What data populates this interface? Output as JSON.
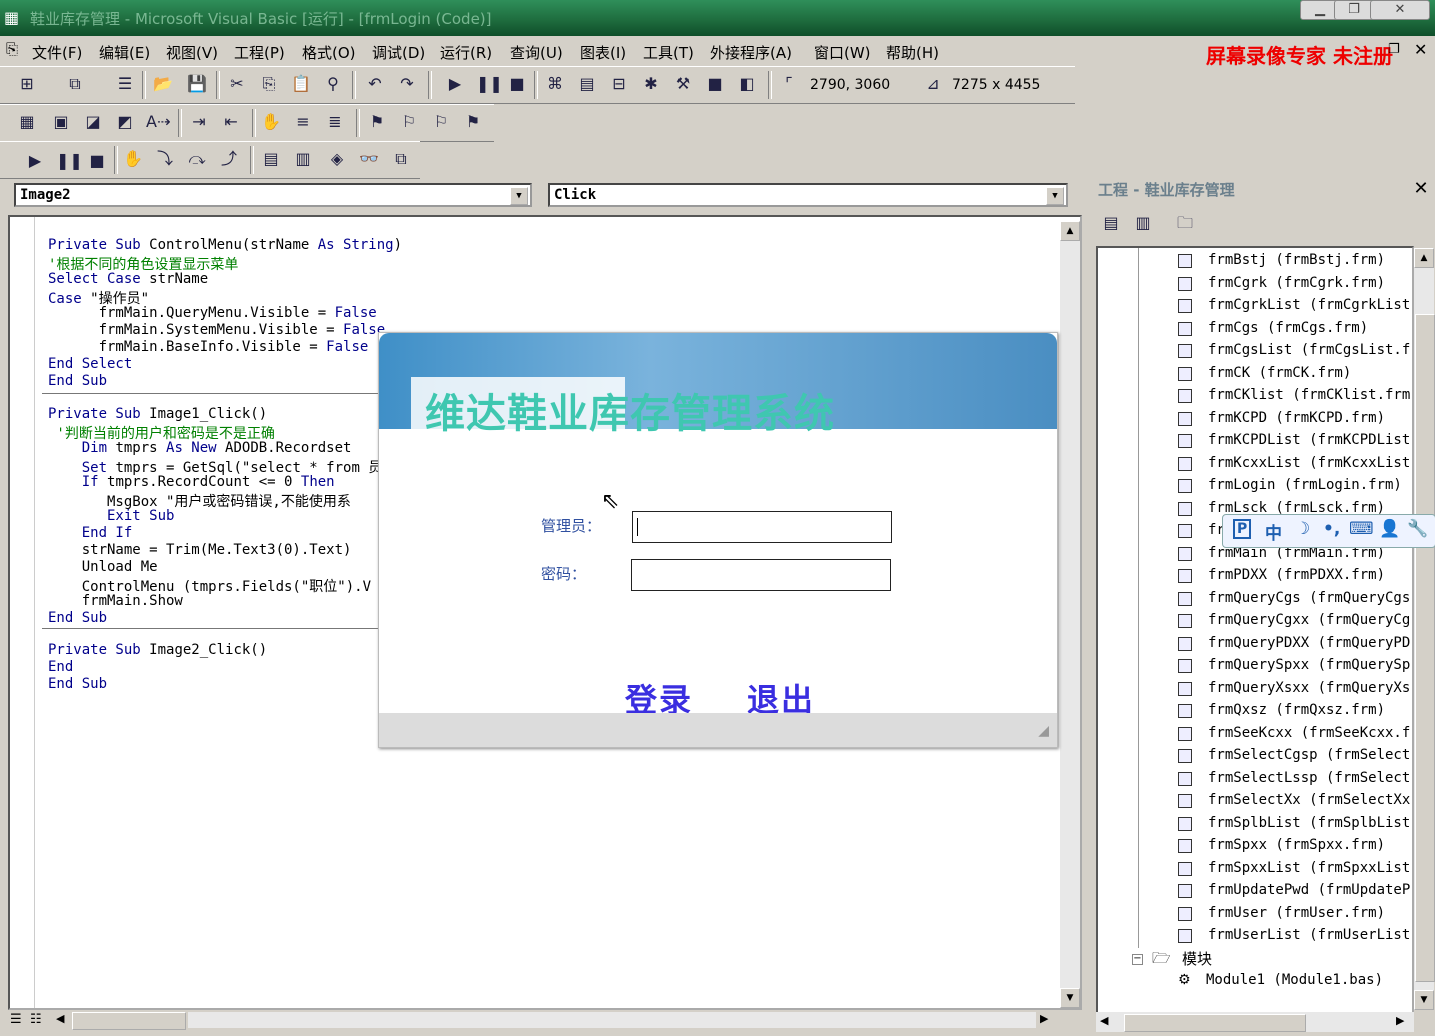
{
  "window": {
    "title": "鞋业库存管理 - Microsoft Visual Basic [运行] - [frmLogin (Code)]"
  },
  "menu": [
    "文件(F)",
    "编辑(E)",
    "视图(V)",
    "工程(P)",
    "格式(O)",
    "调试(D)",
    "运行(R)",
    "查询(U)",
    "图表(I)",
    "工具(T)",
    "外接程序(A)",
    "窗口(W)",
    "帮助(H)"
  ],
  "watermark": "屏幕录像专家  未注册",
  "toolbar": {
    "position": "2790, 3060",
    "size": "7275 x 4455"
  },
  "code_window": {
    "object_combo": "Image2",
    "proc_combo": "Click",
    "lines": [
      "Private Sub ControlMenu(strName As String)",
      "'根据不同的角色设置显示菜单",
      "Select Case strName",
      "Case \"操作员\"",
      "      frmMain.QueryMenu.Visible = False",
      "      frmMain.SystemMenu.Visible = False",
      "      frmMain.BaseInfo.Visible = False",
      "End Select",
      "End Sub",
      "Private Sub Image1_Click()",
      " '判断当前的用户和密码是不是正确",
      "    Dim tmprs As New ADODB.Recordset",
      "    Set tmprs = GetSql(\"select * from 员",
      "    If tmprs.RecordCount <= 0 Then",
      "       MsgBox \"用户或密码错误,不能使用系",
      "       Exit Sub",
      "    End If",
      "    strName = Trim(Me.Text3(0).Text)",
      "    Unload Me",
      "    ControlMenu (tmprs.Fields(\"职位\").V",
      "    frmMain.Show",
      "End Sub",
      "Private Sub Image2_Click()",
      "End",
      "End Sub"
    ]
  },
  "login": {
    "title": "维达鞋业库存管理系统",
    "user_label": "管理员：",
    "pwd_label": "密码：",
    "login_button": "登录",
    "exit_button": "退出"
  },
  "project": {
    "title": "工程 - 鞋业库存管理",
    "items": [
      "frmBstj (frmBstj.frm)",
      "frmCgrk (frmCgrk.frm)",
      "frmCgrkList (frmCgrkList",
      "frmCgs (frmCgs.frm)",
      "frmCgsList (frmCgsList.f",
      "frmCK (frmCK.frm)",
      "frmCKlist (frmCKlist.frm",
      "frmKCPD (frmKCPD.frm)",
      "frmKCPDList (frmKCPDList",
      "frmKcxxList (frmKcxxList",
      "frmLogin (frmLogin.frm)",
      "frmLsck (frmLsck.frm)",
      "fr",
      "frmMain (frmMain.frm)",
      "frmPDXX (frmPDXX.frm)",
      "frmQueryCgs (frmQueryCgs",
      "frmQueryCgxx (frmQueryCg",
      "frmQueryPDXX (frmQueryPD",
      "frmQuerySpxx (frmQuerySp",
      "frmQueryXsxx (frmQueryXs",
      "frmQxsz (frmQxsz.frm)",
      "frmSeeKcxx (frmSeeKcxx.f",
      "frmSelectCgsp (frmSelect",
      "frmSelectLssp (frmSelect",
      "frmSelectXx (frmSelectXx",
      "frmSplbList (frmSplbList",
      "frmSpxx (frmSpxx.frm)",
      "frmSpxxList (frmSpxxList",
      "frmUpdatePwd (frmUpdateP",
      "frmUser (frmUser.frm)",
      "frmUserList (frmUserList"
    ],
    "modules_folder": "模块",
    "module": "Module1 (Module1.bas)"
  },
  "ime": {
    "p": "P",
    "zh": "中",
    "moon": "☽",
    "punct": "•,",
    "kb": "⌨",
    "user": "👤",
    "tool": "🔧"
  }
}
